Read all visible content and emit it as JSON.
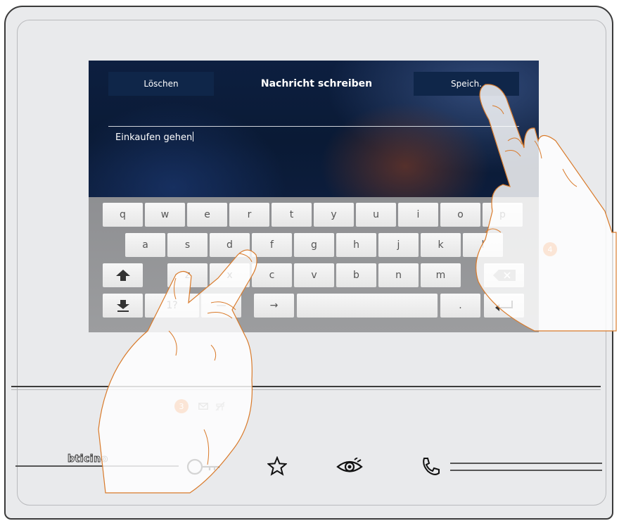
{
  "screen": {
    "delete_label": "Löschen",
    "title": "Nachricht schreiben",
    "save_label": "Speich.",
    "message_text": "Einkaufen gehen"
  },
  "keyboard": {
    "row1": [
      "q",
      "w",
      "e",
      "r",
      "t",
      "y",
      "u",
      "i",
      "o",
      "p"
    ],
    "row2": [
      "a",
      "s",
      "d",
      "f",
      "g",
      "h",
      "j",
      "k",
      "l"
    ],
    "row3": [
      "z",
      "x",
      "c",
      "v",
      "b",
      "n",
      "m"
    ],
    "row4": {
      "symbols": "1?",
      "dash": "—",
      "tab": "→",
      "space": "",
      "dot": "."
    }
  },
  "callouts": {
    "step3": "3",
    "step4": "4"
  },
  "device": {
    "brand": "bticino"
  },
  "icons": {
    "message_icon": "envelope-icon",
    "door_icon": "door-off-icon",
    "key_icon": "key-icon",
    "star_icon": "star-icon",
    "eye_icon": "eye-icon",
    "phone_icon": "phone-icon"
  },
  "colors": {
    "accent": "#e8721f",
    "screen_bg": "#0b1d3b"
  }
}
